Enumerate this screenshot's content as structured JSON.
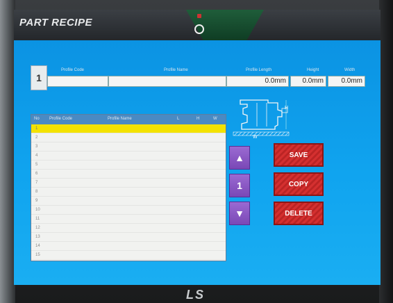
{
  "title": "PART RECIPE",
  "brand": "LS",
  "recipe": {
    "number": "1",
    "headers": [
      "Profile Code",
      "Profile Name",
      "Profile Length",
      "Height",
      "Width"
    ],
    "length_value": "0.0mm",
    "height_value": "0.0mm",
    "width_value": "0.0mm"
  },
  "diagram": {
    "h_label": "H",
    "w_label": "W"
  },
  "list": {
    "headers": [
      "No",
      "Profile Code",
      "Profile Name",
      "L",
      "H",
      "W"
    ],
    "rows": [
      "1",
      "2",
      "3",
      "4",
      "5",
      "6",
      "7",
      "8",
      "9",
      "10",
      "11",
      "12",
      "13",
      "14",
      "15"
    ],
    "selected_index": 0
  },
  "nav": {
    "up_icon": "▲",
    "page": "1",
    "down_icon": "▼"
  },
  "actions": {
    "save": "SAVE",
    "copy": "COPY",
    "delete": "DELETE"
  },
  "colors": {
    "screen_bg": "#10a4ef",
    "selected_row": "#f3e200",
    "action": "#d43030",
    "nav": "#8a58c6"
  }
}
